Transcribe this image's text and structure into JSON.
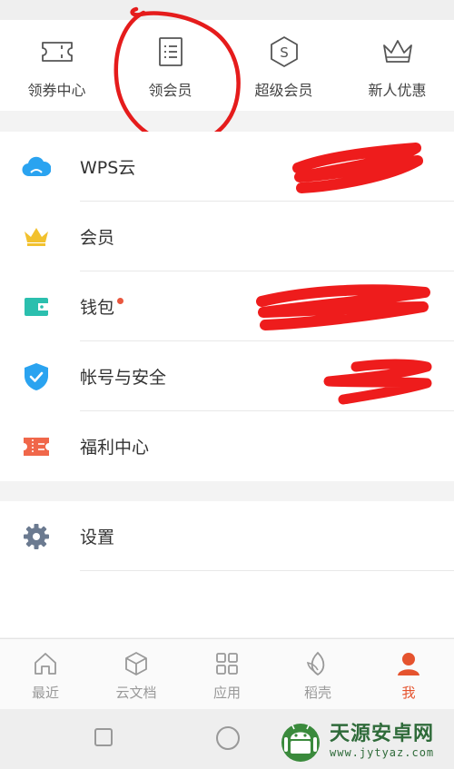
{
  "quick_actions": [
    {
      "label": "领券中心",
      "icon": "coupon-icon"
    },
    {
      "label": "领会员",
      "icon": "list-card-icon"
    },
    {
      "label": "超级会员",
      "icon": "super-member-s-icon"
    },
    {
      "label": "新人优惠",
      "icon": "crown-outline-icon"
    }
  ],
  "menu": [
    {
      "label": "WPS云",
      "icon": "cloud-icon",
      "color": "#2aa3f0"
    },
    {
      "label": "会员",
      "icon": "crown-icon",
      "color": "#f2c12e"
    },
    {
      "label": "钱包",
      "icon": "wallet-icon",
      "color": "#2bbfae",
      "badge_dot": true
    },
    {
      "label": "帐号与安全",
      "icon": "shield-check-icon",
      "color": "#2aa3f0"
    },
    {
      "label": "福利中心",
      "icon": "ticket-icon",
      "color": "#f0674a"
    }
  ],
  "settings": {
    "label": "设置",
    "icon": "gear-icon",
    "color": "#6b7a90"
  },
  "tabs": [
    {
      "label": "最近",
      "icon": "home-icon",
      "active": false
    },
    {
      "label": "云文档",
      "icon": "cube-icon",
      "active": false
    },
    {
      "label": "应用",
      "icon": "grid-icon",
      "active": false
    },
    {
      "label": "稻壳",
      "icon": "leaf-icon",
      "active": false
    },
    {
      "label": "我",
      "icon": "person-icon",
      "active": true
    }
  ],
  "colors": {
    "accent": "#e5532e",
    "redaction": "#ee1c1c",
    "annotation": "#e51c1c"
  },
  "watermark": {
    "title": "天源安卓网",
    "url": "www.jytyaz.com"
  }
}
